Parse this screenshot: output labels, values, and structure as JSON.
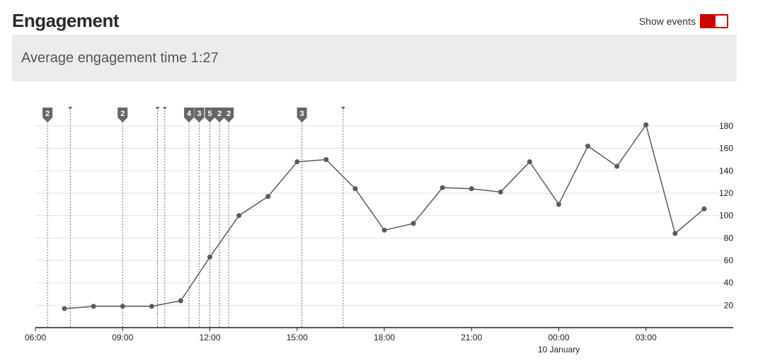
{
  "header": {
    "title": "Engagement"
  },
  "toggle": {
    "label": "Show events",
    "on": true,
    "color": "#cc0000"
  },
  "banner": {
    "text": "Average engagement time 1:27"
  },
  "chart_data": {
    "type": "line",
    "x_start": "06:00",
    "x_end": "06:00 +1d",
    "xlim_hours": [
      0,
      24
    ],
    "ylim": [
      0,
      180
    ],
    "y_ticks": [
      20,
      40,
      60,
      80,
      100,
      120,
      140,
      160,
      180
    ],
    "x_ticks": [
      {
        "hour": 0,
        "label": "06:00"
      },
      {
        "hour": 3,
        "label": "09:00"
      },
      {
        "hour": 6,
        "label": "12:00"
      },
      {
        "hour": 9,
        "label": "15:00"
      },
      {
        "hour": 12,
        "label": "18:00"
      },
      {
        "hour": 15,
        "label": "21:00"
      },
      {
        "hour": 18,
        "label": "00:00",
        "sublabel": "10 January"
      },
      {
        "hour": 21,
        "label": "03:00"
      }
    ],
    "grid": true,
    "line_color": "#5b5b5b",
    "series": [
      {
        "x": [
          "07:00",
          "08:00",
          "09:00",
          "10:00",
          "11:00",
          "12:00",
          "13:00",
          "14:00",
          "15:00",
          "16:00",
          "17:00",
          "18:00",
          "19:00",
          "20:00",
          "21:00",
          "22:00",
          "23:00",
          "00:00",
          "01:00",
          "02:00",
          "03:00",
          "04:00",
          "05:00"
        ],
        "values": [
          17,
          19,
          19,
          19,
          24,
          63,
          100,
          117,
          148,
          150,
          124,
          87,
          93,
          125,
          124,
          121,
          148,
          110,
          162,
          144,
          181,
          84,
          106
        ]
      }
    ],
    "events": [
      {
        "time": "06:25",
        "count": "2"
      },
      {
        "time": "07:12",
        "count": ""
      },
      {
        "time": "09:00",
        "count": "2"
      },
      {
        "time": "10:12",
        "count": ""
      },
      {
        "time": "10:27",
        "count": ""
      },
      {
        "time": "11:17",
        "count": "4"
      },
      {
        "time": "11:38",
        "count": "3"
      },
      {
        "time": "12:00",
        "count": "5"
      },
      {
        "time": "12:20",
        "count": "2"
      },
      {
        "time": "12:39",
        "count": "2"
      },
      {
        "time": "15:10",
        "count": "3"
      },
      {
        "time": "16:35",
        "count": ""
      }
    ]
  }
}
